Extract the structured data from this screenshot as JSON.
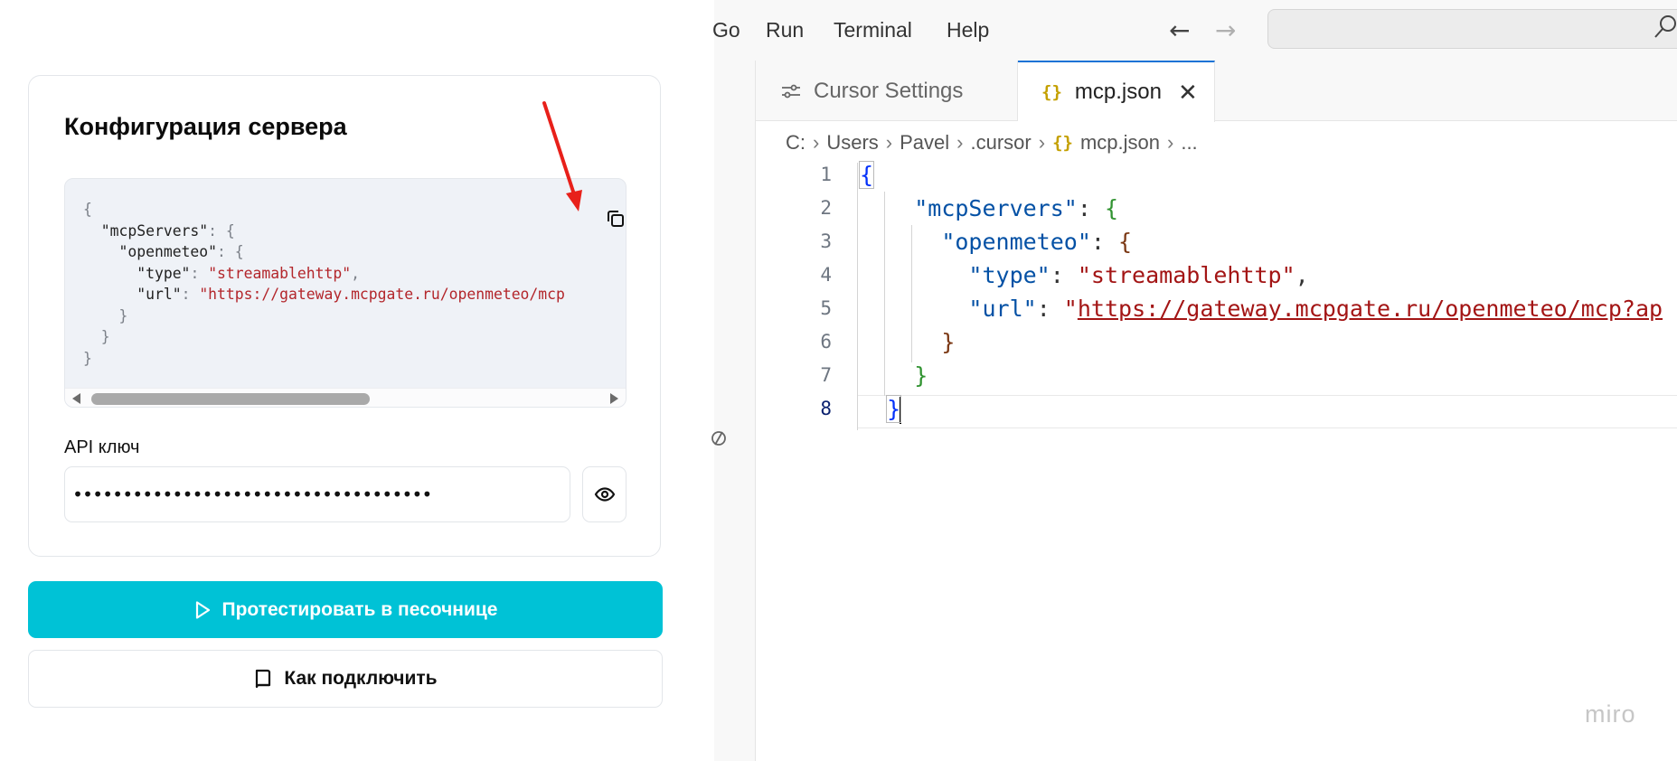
{
  "left_panel": {
    "card_title": "Конфигурация сервера",
    "code_lines": [
      "{",
      "  \"mcpServers\": {",
      "    \"openmeteo\": {",
      "      \"type\": \"streamablehttp\",",
      "      \"url\": \"https://gateway.mcpgate.ru/openmeteo/mcp",
      "    }",
      "  }",
      "}"
    ],
    "code": {
      "mcpServers_key": "\"mcpServers\"",
      "openmeteo_key": "\"openmeteo\"",
      "type_key": "\"type\"",
      "type_value": "\"streamablehttp\"",
      "url_key": "\"url\"",
      "url_value": "\"https://gateway.mcpgate.ru/openmeteo/mcp"
    },
    "copy_icon": "copy-icon",
    "api_label": "API ключ",
    "api_value": "••••••••••••••••••••••••••••••••••••",
    "eye_icon": "eye-icon",
    "primary_button": "Протестировать в песочнице",
    "secondary_button": "Как подключить",
    "annotation_color": "#e8201a",
    "accent_color": "#00c2d6"
  },
  "right_panel": {
    "menu": [
      "Go",
      "Run",
      "Terminal",
      "Help"
    ],
    "tabs": [
      {
        "label": "Cursor Settings",
        "icon": "settings-sliders-icon"
      },
      {
        "label": "mcp.json",
        "icon": "json-braces-icon"
      }
    ],
    "json_icon_glyph": "{}",
    "breadcrumb": [
      "C:",
      "Users",
      "Pavel",
      ".cursor",
      "mcp.json",
      "..."
    ],
    "line_numbers": [
      "1",
      "2",
      "3",
      "4",
      "5",
      "6",
      "7",
      "8"
    ],
    "editor": {
      "l1": "{",
      "l2_key": "\"mcpServers\"",
      "l3_key": "\"openmeteo\"",
      "l4_key": "\"type\"",
      "l4_val": "\"streamablehttp\"",
      "l5_key": "\"url\"",
      "l5_quote": "\"",
      "l5_val": "https://gateway.mcpgate.ru/openmeteo/mcp?ap",
      "l6": "}",
      "l7": "}",
      "l8": "}"
    },
    "watermark": "miro"
  }
}
